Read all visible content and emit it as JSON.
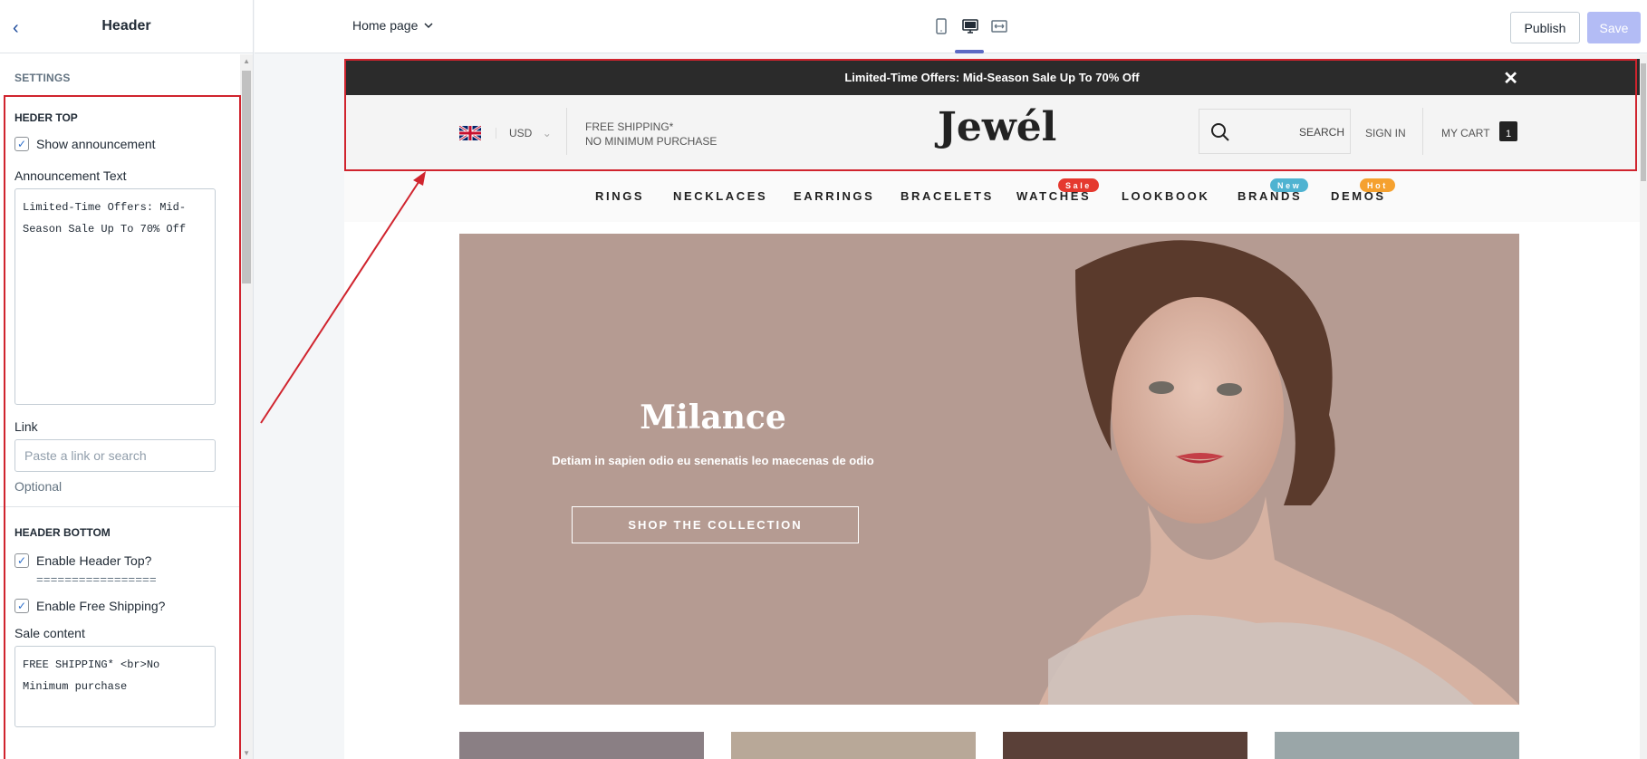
{
  "sidebar": {
    "title": "Header",
    "settings_label": "SETTINGS",
    "header_top": {
      "heading": "HEDER TOP",
      "show_announcement": "Show announcement",
      "announcement_label": "Announcement Text",
      "announcement_value": "Limited-Time Offers: Mid-\nSeason Sale Up To 70% Off",
      "link_label": "Link",
      "link_placeholder": "Paste a link or search",
      "link_help": "Optional"
    },
    "header_bottom": {
      "heading": "HEADER BOTTOM",
      "enable_header_top": "Enable Header Top?",
      "separator": "=================",
      "enable_free_shipping": "Enable Free Shipping?",
      "sale_content_label": "Sale content",
      "sale_content_value": "FREE SHIPPING* <br>No\nMinimum purchase"
    }
  },
  "topbar": {
    "page_selector": "Home page",
    "publish": "Publish",
    "save": "Save"
  },
  "preview": {
    "announcement": "Limited-Time Offers: Mid-Season Sale Up To 70% Off",
    "currency": "USD",
    "shipping_line1": "FREE SHIPPING*",
    "shipping_line2": "NO MINIMUM PURCHASE",
    "logo": "Jewél",
    "search": "SEARCH",
    "sign_in": "SIGN IN",
    "my_cart": "MY CART",
    "cart_count": "1",
    "nav": [
      "RINGS",
      "NECKLACES",
      "EARRINGS",
      "BRACELETS",
      "WATCHES",
      "LOOKBOOK",
      "BRANDS",
      "DEMOS"
    ],
    "tags": {
      "sale": "Sale",
      "new": "New",
      "hot": "Hot"
    },
    "tag_colors": {
      "sale": "#e5392f",
      "new": "#4fb3d1",
      "hot": "#f5a12f"
    },
    "hero_title": "Milance",
    "hero_subtitle": "Detiam in sapien odio eu senenatis leo maecenas de odio",
    "hero_button": "SHOP THE COLLECTION"
  }
}
